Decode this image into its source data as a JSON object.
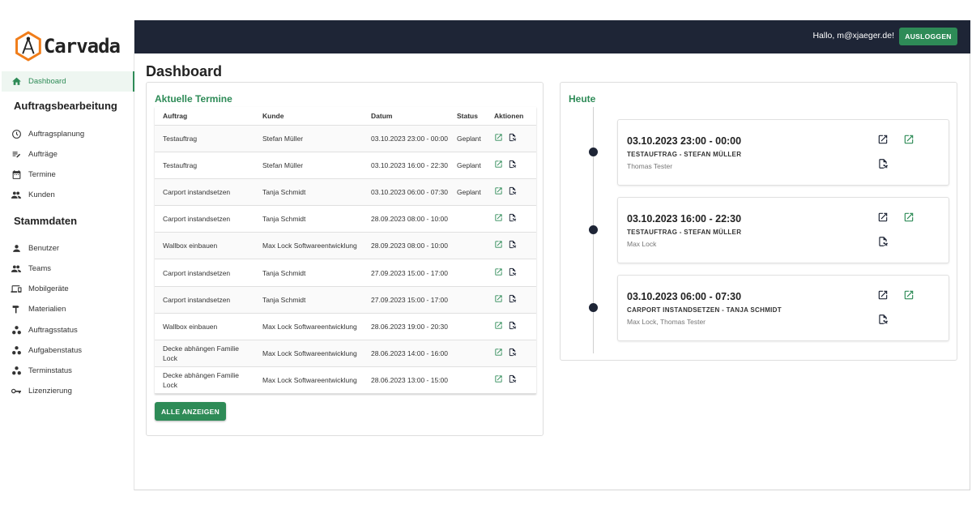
{
  "app": {
    "logo_text": "Carvada"
  },
  "sidebar": {
    "items": [
      {
        "label": "Dashboard",
        "icon": "home-icon",
        "active": true
      },
      {
        "label": "Auftragsplanung",
        "icon": "clock-icon"
      },
      {
        "label": "Aufträge",
        "icon": "edit-list-icon"
      },
      {
        "label": "Termine",
        "icon": "calendar-icon"
      },
      {
        "label": "Kunden",
        "icon": "people-icon"
      },
      {
        "label": "Benutzer",
        "icon": "person-icon"
      },
      {
        "label": "Teams",
        "icon": "people-icon"
      },
      {
        "label": "Mobilgeräte",
        "icon": "devices-icon"
      },
      {
        "label": "Materialien",
        "icon": "hammer-icon"
      },
      {
        "label": "Auftragsstatus",
        "icon": "bubbles-icon"
      },
      {
        "label": "Aufgabenstatus",
        "icon": "bubbles-icon"
      },
      {
        "label": "Terminstatus",
        "icon": "bubbles-icon"
      },
      {
        "label": "Lizenzierung",
        "icon": "key-icon"
      }
    ],
    "sections": [
      "Auftragsbearbeitung",
      "Stammdaten"
    ]
  },
  "topbar": {
    "greeting": "Hallo, m@xjaeger.de!",
    "logout_label": "AUSLOGGEN"
  },
  "page": {
    "title": "Dashboard"
  },
  "termine": {
    "title": "Aktuelle Termine",
    "columns": [
      "Auftrag",
      "Kunde",
      "Datum",
      "Status",
      "Aktionen"
    ],
    "rows": [
      {
        "auftrag": "Testauftrag",
        "kunde": "Stefan Müller",
        "datum": "03.10.2023 23:00 - 00:00",
        "status": "Geplant"
      },
      {
        "auftrag": "Testauftrag",
        "kunde": "Stefan Müller",
        "datum": "03.10.2023 16:00 - 22:30",
        "status": "Geplant"
      },
      {
        "auftrag": "Carport instandsetzen",
        "kunde": "Tanja Schmidt",
        "datum": "03.10.2023 06:00 - 07:30",
        "status": "Geplant"
      },
      {
        "auftrag": "Carport instandsetzen",
        "kunde": "Tanja Schmidt",
        "datum": "28.09.2023 08:00 - 10:00",
        "status": ""
      },
      {
        "auftrag": "Wallbox einbauen",
        "kunde": "Max Lock Softwareentwicklung",
        "datum": "28.09.2023 08:00 - 10:00",
        "status": ""
      },
      {
        "auftrag": "Carport instandsetzen",
        "kunde": "Tanja Schmidt",
        "datum": "27.09.2023 15:00 - 17:00",
        "status": ""
      },
      {
        "auftrag": "Carport instandsetzen",
        "kunde": "Tanja Schmidt",
        "datum": "27.09.2023 15:00 - 17:00",
        "status": ""
      },
      {
        "auftrag": "Wallbox einbauen",
        "kunde": "Max Lock Softwareentwicklung",
        "datum": "28.06.2023 19:00 - 20:30",
        "status": ""
      },
      {
        "auftrag": "Decke abhängen Familie Lock",
        "kunde": "Max Lock Softwareentwicklung",
        "datum": "28.06.2023 14:00 - 16:00",
        "status": ""
      },
      {
        "auftrag": "Decke abhängen Familie Lock",
        "kunde": "Max Lock Softwareentwicklung",
        "datum": "28.06.2023 13:00 - 15:00",
        "status": ""
      }
    ],
    "all_button": "ALLE ANZEIGEN"
  },
  "heute": {
    "title": "Heute",
    "appointments": [
      {
        "time": "03.10.2023 23:00 - 00:00",
        "title": "TESTAUFTRAG - STEFAN MÜLLER",
        "people": "Thomas Tester"
      },
      {
        "time": "03.10.2023 16:00 - 22:30",
        "title": "TESTAUFTRAG - STEFAN MÜLLER",
        "people": "Max Lock"
      },
      {
        "time": "03.10.2023 06:00 - 07:30",
        "title": "CARPORT INSTANDSETZEN - TANJA SCHMIDT",
        "people": "Max Lock, Thomas Tester"
      }
    ]
  },
  "colors": {
    "accent": "#2e8b57",
    "topbar": "#1e2536",
    "dot": "#1e2536"
  }
}
